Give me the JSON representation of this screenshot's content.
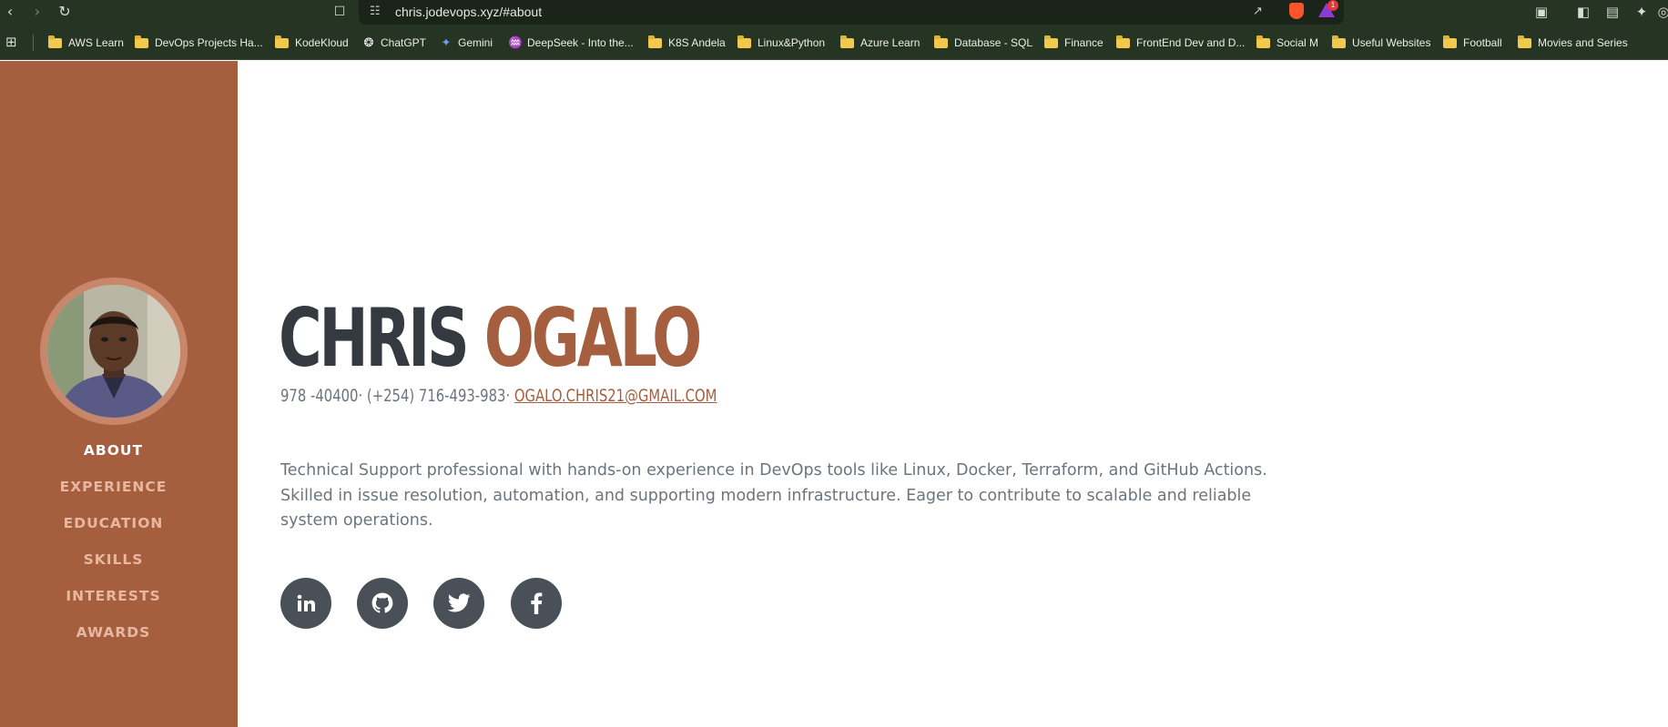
{
  "browser": {
    "url": "chris.jodevops.xyz/#about",
    "rewards_badge": "1",
    "bookmarks": [
      {
        "label": "AWS Learn",
        "icon": "folder-icon"
      },
      {
        "label": "DevOps Projects Ha...",
        "icon": "folder-icon"
      },
      {
        "label": "KodeKloud",
        "icon": "folder-icon"
      },
      {
        "label": "ChatGPT",
        "icon": "chatgpt-icon"
      },
      {
        "label": "Gemini",
        "icon": "gemini-icon"
      },
      {
        "label": "DeepSeek - Into the...",
        "icon": "deepseek-icon"
      },
      {
        "label": "K8S Andela",
        "icon": "folder-icon"
      },
      {
        "label": "Linux&Python",
        "icon": "folder-icon"
      },
      {
        "label": "Azure Learn",
        "icon": "folder-icon"
      },
      {
        "label": "Database - SQL",
        "icon": "folder-icon"
      },
      {
        "label": "Finance",
        "icon": "folder-icon"
      },
      {
        "label": "FrontEnd Dev and D...",
        "icon": "folder-icon"
      },
      {
        "label": "Social M",
        "icon": "folder-icon"
      },
      {
        "label": "Useful Websites",
        "icon": "folder-icon"
      },
      {
        "label": "Football",
        "icon": "folder-icon"
      },
      {
        "label": "Movies and Series",
        "icon": "folder-icon"
      }
    ]
  },
  "sidebar": {
    "nav": [
      {
        "label": "ABOUT",
        "active": true
      },
      {
        "label": "EXPERIENCE",
        "active": false
      },
      {
        "label": "EDUCATION",
        "active": false
      },
      {
        "label": "SKILLS",
        "active": false
      },
      {
        "label": "INTERESTS",
        "active": false
      },
      {
        "label": "AWARDS",
        "active": false
      }
    ]
  },
  "about": {
    "first_name": "CHRIS",
    "last_name": "OGALO",
    "contact_text": "978 -40400· (+254) 716-493-983· ",
    "email": "OGALO.CHRIS21@GMAIL.COM",
    "bio": "Technical Support professional with hands-on experience in DevOps tools like Linux, Docker, Terraform, and GitHub Actions. Skilled in issue resolution, automation, and supporting modern infrastructure. Eager to contribute to scalable and reliable system operations.",
    "social": [
      {
        "icon": "linkedin-icon"
      },
      {
        "icon": "github-icon"
      },
      {
        "icon": "twitter-icon"
      },
      {
        "icon": "facebook-icon"
      }
    ]
  },
  "colors": {
    "chrome_bg": "#263424",
    "sidebar_bg": "#a55f3f",
    "accent": "#a55f3f",
    "name_dark": "#343a40",
    "text_muted": "#6c757d",
    "social_bg": "#495057"
  }
}
